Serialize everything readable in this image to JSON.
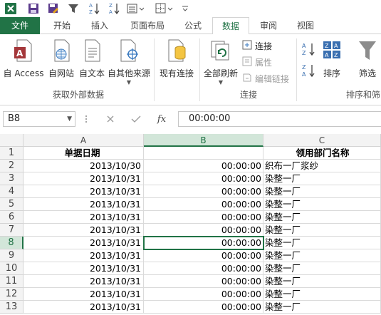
{
  "ribbon_tabs": {
    "file": "文件",
    "home": "开始",
    "insert": "插入",
    "page_layout": "页面布局",
    "formulas": "公式",
    "data": "数据",
    "review": "审阅",
    "view": "视图"
  },
  "ribbon": {
    "from_access": "自 Access",
    "from_web": "自网站",
    "from_text": "自文本",
    "from_other": "自其他来源",
    "existing_connections": "现有连接",
    "refresh_all": "全部刷新",
    "connections": "连接",
    "properties": "属性",
    "edit_links": "编辑链接",
    "sort": "排序",
    "filter": "筛选",
    "group_get_external": "获取外部数据",
    "group_connections": "连接",
    "group_sort_filter": "排序和筛"
  },
  "formula_bar": {
    "name_box": "B8",
    "formula": "00:00:00"
  },
  "columns": [
    "A",
    "B",
    "C"
  ],
  "rows": [
    {
      "num": "1",
      "a": "单据日期",
      "b": "",
      "c": "领用部门名称"
    },
    {
      "num": "2",
      "a": "2013/10/30",
      "b": "00:00:00",
      "c": "织布一厂浆纱"
    },
    {
      "num": "3",
      "a": "2013/10/31",
      "b": "00:00:00",
      "c": "染整一厂"
    },
    {
      "num": "4",
      "a": "2013/10/31",
      "b": "00:00:00",
      "c": "染整一厂"
    },
    {
      "num": "5",
      "a": "2013/10/31",
      "b": "00:00:00",
      "c": "染整一厂"
    },
    {
      "num": "6",
      "a": "2013/10/31",
      "b": "00:00:00",
      "c": "染整一厂"
    },
    {
      "num": "7",
      "a": "2013/10/31",
      "b": "00:00:00",
      "c": "染整一厂"
    },
    {
      "num": "8",
      "a": "2013/10/31",
      "b": "00:00:00",
      "c": "染整一厂"
    },
    {
      "num": "9",
      "a": "2013/10/31",
      "b": "00:00:00",
      "c": "染整一厂"
    },
    {
      "num": "10",
      "a": "2013/10/31",
      "b": "00:00:00",
      "c": "染整一厂"
    },
    {
      "num": "11",
      "a": "2013/10/31",
      "b": "00:00:00",
      "c": "染整一厂"
    },
    {
      "num": "12",
      "a": "2013/10/31",
      "b": "00:00:00",
      "c": "染整一厂"
    },
    {
      "num": "13",
      "a": "2013/10/31",
      "b": "00:00:00",
      "c": "染整一厂"
    }
  ],
  "selected_cell": "B8",
  "colors": {
    "excel_green": "#217346",
    "header_bg": "#f3f3f3",
    "selected_header_bg": "#d2e6d9"
  }
}
